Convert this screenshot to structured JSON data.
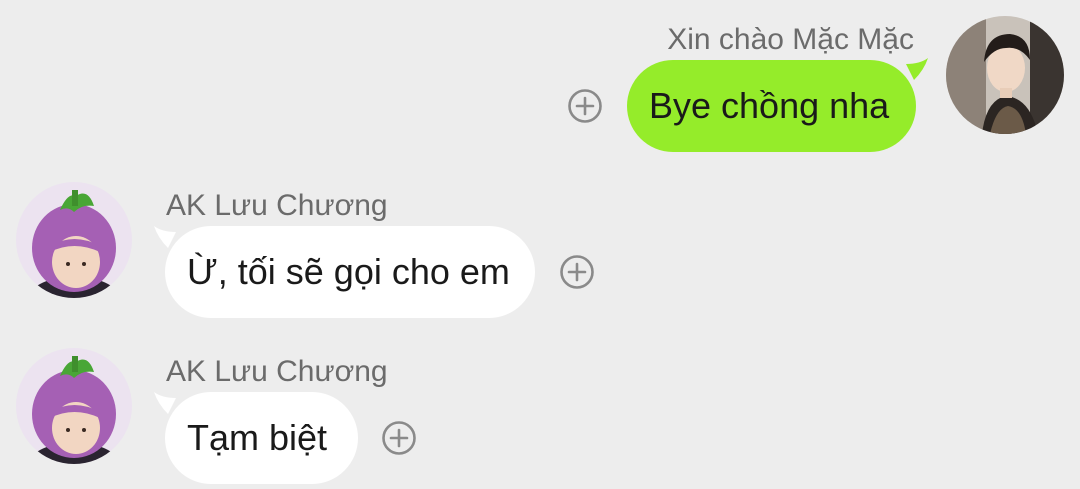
{
  "messages": [
    {
      "sender": "Xin chào Mặc Mặc",
      "text": "Bye chồng nha",
      "direction": "outgoing",
      "avatar_icon": "young-man-portrait-avatar",
      "react_icon": "add-reaction-icon"
    },
    {
      "sender": "AK Lưu Chương",
      "text": "Ừ, tối sẽ gọi cho em",
      "direction": "incoming",
      "avatar_icon": "eggplant-hat-avatar",
      "react_icon": "add-reaction-icon"
    },
    {
      "sender": "AK Lưu Chương",
      "text": "Tạm biệt",
      "direction": "incoming",
      "avatar_icon": "eggplant-hat-avatar",
      "react_icon": "add-reaction-icon"
    }
  ],
  "colors": {
    "background": "#ededed",
    "outgoing_bubble": "#95ec2a",
    "incoming_bubble": "#ffffff",
    "sender_name": "#6b6b6b",
    "react_icon": "#8a8a8a"
  }
}
